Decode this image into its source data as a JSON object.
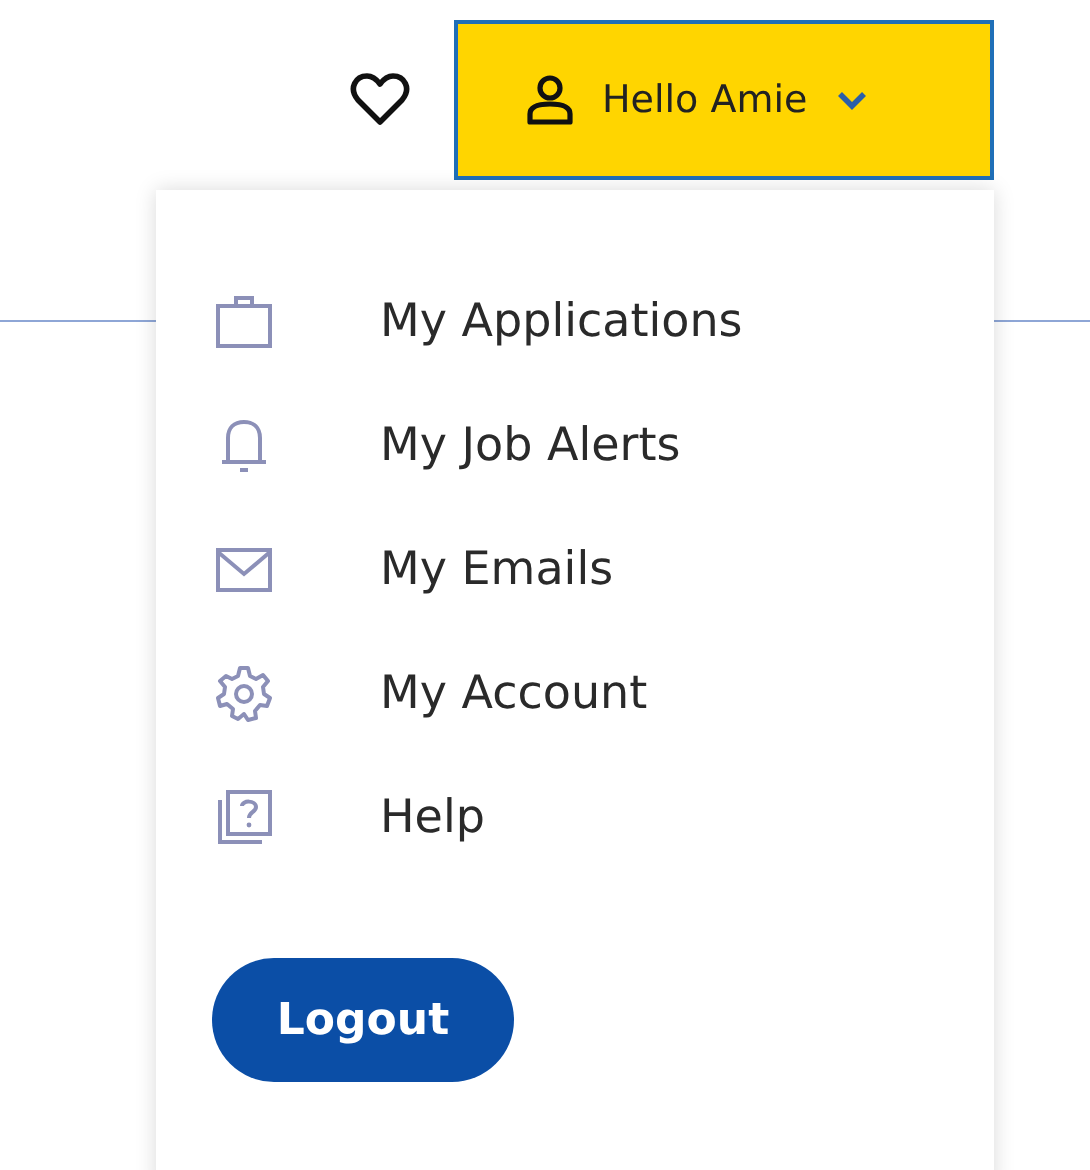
{
  "account_button": {
    "label": "Hello Amie",
    "expanded": true
  },
  "menu": {
    "items": [
      {
        "kind": "briefcase",
        "label": "My Applications"
      },
      {
        "kind": "bell",
        "label": "My Job Alerts"
      },
      {
        "kind": "envelope",
        "label": "My Emails"
      },
      {
        "kind": "gear",
        "label": "My Account"
      },
      {
        "kind": "help",
        "label": "Help"
      }
    ],
    "logout": "Logout"
  }
}
